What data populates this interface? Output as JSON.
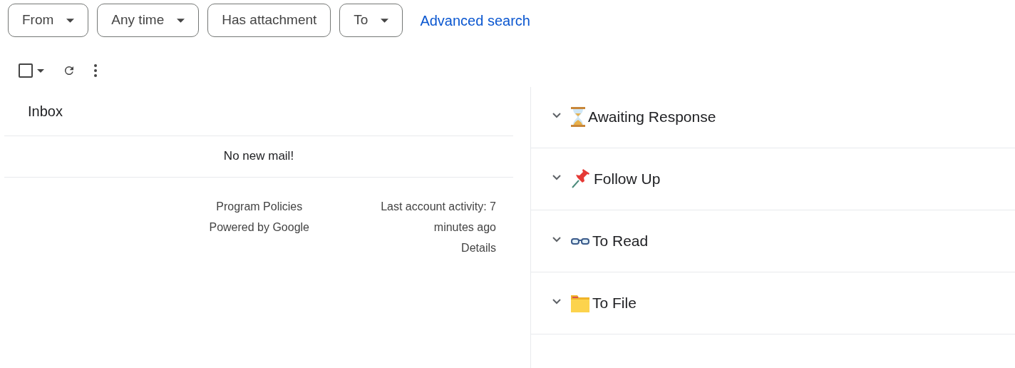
{
  "filters": [
    {
      "label": "From",
      "dropdown": true
    },
    {
      "label": "Any time",
      "dropdown": true
    },
    {
      "label": "Has attachment",
      "dropdown": false
    },
    {
      "label": "To",
      "dropdown": true
    }
  ],
  "advanced_search": "Advanced search",
  "toolbar": {
    "select_all_checked": false
  },
  "inbox": {
    "title": "Inbox",
    "empty_message": "No new mail!"
  },
  "footer": {
    "links": [
      "Program Policies",
      "Powered by Google"
    ],
    "activity": "Last account activity: 7 minutes ago",
    "details": "Details"
  },
  "sections": [
    {
      "kind": "hourglass",
      "title": "Awaiting Response",
      "expanded": true
    },
    {
      "kind": "pin",
      "title": "Follow Up",
      "expanded": true
    },
    {
      "kind": "glasses",
      "title": "To Read",
      "expanded": true
    },
    {
      "kind": "folder",
      "title": "To File",
      "expanded": true
    }
  ]
}
